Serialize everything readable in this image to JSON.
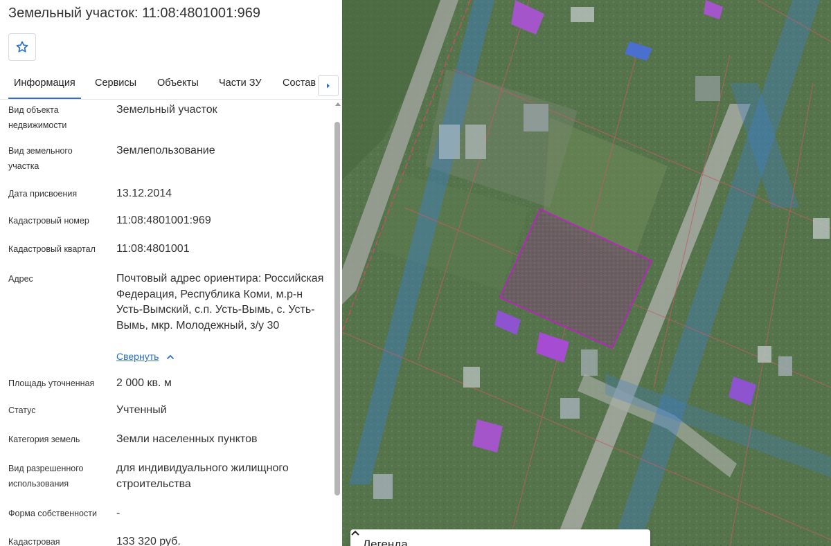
{
  "header": {
    "title": "Земельный участок: 11:08:4801001:969"
  },
  "favorite": {
    "icon": "star-outline-icon"
  },
  "tabs": [
    {
      "label": "Информация",
      "active": true
    },
    {
      "label": "Сервисы"
    },
    {
      "label": "Объекты"
    },
    {
      "label": "Части ЗУ"
    },
    {
      "label": "Состав"
    }
  ],
  "info": {
    "object_type": {
      "label": "Вид объекта недвижимости",
      "value": "Земельный участок"
    },
    "land_type": {
      "label": "Вид земельного участка",
      "value": "Землепользование"
    },
    "assign_date": {
      "label": "Дата присвоения",
      "value": "13.12.2014"
    },
    "cad_number": {
      "label": "Кадастровый номер",
      "value": "11:08:4801001:969"
    },
    "cad_quarter": {
      "label": "Кадастровый квартал",
      "value": "11:08:4801001"
    },
    "address": {
      "label": "Адрес",
      "value": "Почтовый адрес ориентира: Российская Федерация, Республика Коми, м.р-н Усть-Вымский, с.п. Усть-Вымь, с. Усть-Вымь, мкр. Молодежный, з/у 30",
      "collapse": "Свернуть"
    },
    "area": {
      "label": "Площадь уточненная",
      "value": "2 000 кв. м"
    },
    "status": {
      "label": "Статус",
      "value": "Учтенный"
    },
    "category": {
      "label": "Категория земель",
      "value": "Земли населенных пунктов"
    },
    "permitted_use": {
      "label": "Вид разрешенного использования",
      "value": "для индивидуального жилищного строительства"
    },
    "ownership": {
      "label": "Форма собственности",
      "value": "-"
    },
    "cad_value": {
      "label": "Кадастровая",
      "value": "133 320 руб."
    }
  },
  "map": {
    "legend_title": "Легенда"
  },
  "colors": {
    "accent": "#2b6fc9",
    "parcel_outline": "#c21ec8"
  }
}
